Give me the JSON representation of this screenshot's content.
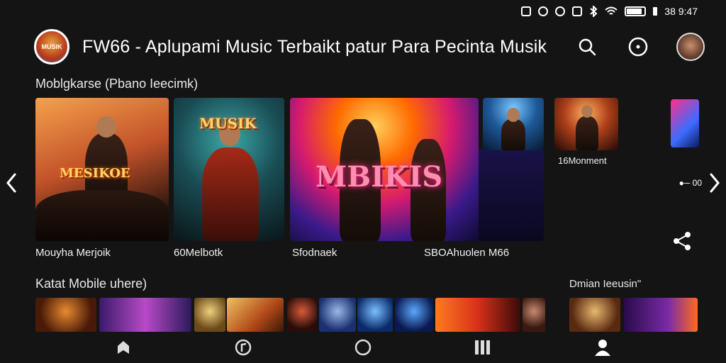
{
  "status_bar": {
    "time": "38 9:47",
    "icons": [
      "notification-icon",
      "alarm-icon",
      "location-icon",
      "nfc-icon",
      "bluetooth-icon",
      "wifi-icon",
      "battery-icon"
    ],
    "battery_level": 0.85
  },
  "header": {
    "title": "FW66 - Aplupami Music Terbaikt patur Para Pecinta Musik",
    "logo_text": "MUSIK",
    "actions": [
      "search-icon",
      "chat-icon",
      "user-avatar"
    ]
  },
  "section1": {
    "title": "Moblgkarse (Pbano Ieecimk)",
    "cards": [
      {
        "label": "Mouyha Merjoik",
        "art_text": "MESIKOE"
      },
      {
        "label": "60Melbotk",
        "art_text": "MUSIK"
      },
      {
        "label": "Sfodnaek",
        "art_text": "MBIKIS"
      },
      {
        "label": "SBOAhuolen M66",
        "art_text": ""
      },
      {
        "label": "16Monment",
        "art_text": ""
      }
    ]
  },
  "section2": {
    "title": "Katat Mobile uhere)",
    "side_title": "Dmian Ieeusin\""
  },
  "side": {
    "label": "●─ 00"
  },
  "bottom_nav": [
    "home-icon",
    "music-note-icon",
    "circle-icon",
    "library-icon",
    "profile-icon"
  ],
  "colors": {
    "background": "#141414",
    "accent": "#ff6a00",
    "text": "#f2f2f2"
  }
}
